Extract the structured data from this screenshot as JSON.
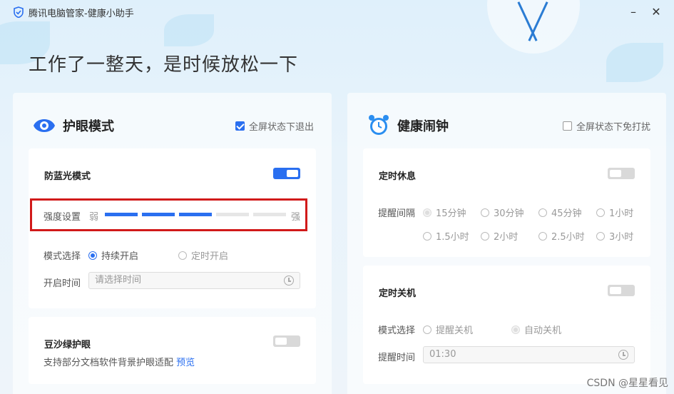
{
  "app": {
    "title": "腾讯电脑管家-健康小助手"
  },
  "headline": "工作了一整天，是时候放松一下",
  "eye_panel": {
    "title": "护眼模式",
    "fullscreen_label": "全屏状态下退出",
    "fullscreen_checked": true,
    "blue_light": {
      "title": "防蓝光模式",
      "enabled": true,
      "strength_label": "强度设置",
      "weak_label": "弱",
      "strong_label": "强",
      "strength_level": 3,
      "strength_max": 5,
      "mode_label": "模式选择",
      "mode_options": [
        "持续开启",
        "定时开启"
      ],
      "mode_selected": "持续开启",
      "time_label": "开启时间",
      "time_placeholder": "请选择时间"
    },
    "green": {
      "title": "豆沙绿护眼",
      "enabled": false,
      "desc": "支持部分文档软件背景护眼适配",
      "preview_link": "预览"
    }
  },
  "alarm_panel": {
    "title": "健康闹钟",
    "fullscreen_label": "全屏状态下免打扰",
    "fullscreen_checked": false,
    "rest": {
      "title": "定时休息",
      "enabled": false,
      "interval_label": "提醒间隔",
      "options": [
        "15分钟",
        "30分钟",
        "45分钟",
        "1小时",
        "1.5小时",
        "2小时",
        "2.5小时",
        "3小时"
      ],
      "selected": "15分钟"
    },
    "shutdown": {
      "title": "定时关机",
      "enabled": false,
      "mode_label": "模式选择",
      "mode_options": [
        "提醒关机",
        "自动关机"
      ],
      "mode_selected": "自动关机",
      "time_label": "提醒时间",
      "time_value": "01:30"
    }
  },
  "colors": {
    "accent": "#2a6ff0",
    "highlight_box": "#d11a1a",
    "segment_off": "#e6e6e6"
  },
  "watermark": "CSDN @星星看见"
}
